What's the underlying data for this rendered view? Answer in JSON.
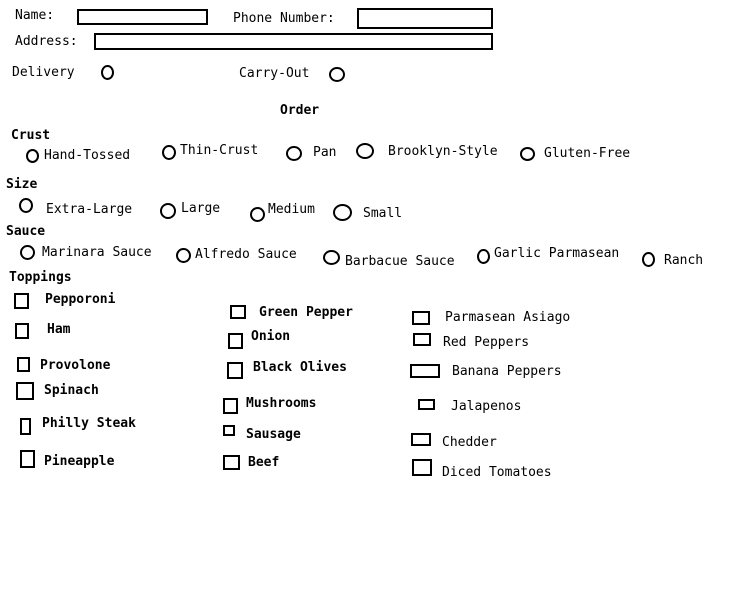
{
  "contact": {
    "name_label": "Name:",
    "phone_label": "Phone Number:",
    "address_label": "Address:",
    "name_value": "",
    "phone_value": "",
    "address_value": ""
  },
  "service": {
    "delivery": "Delivery",
    "carryout": "Carry-Out"
  },
  "order_heading": "Order",
  "crust": {
    "heading": "Crust",
    "options": [
      "Hand-Tossed",
      "Thin-Crust",
      "Pan",
      "Brooklyn-Style",
      "Gluten-Free"
    ]
  },
  "size": {
    "heading": "Size",
    "options": [
      "Extra-Large",
      "Large",
      "Medium",
      "Small"
    ]
  },
  "sauce": {
    "heading": "Sauce",
    "options": [
      "Marinara Sauce",
      "Alfredo Sauce",
      "Barbacue Sauce",
      "Garlic Parmasean",
      "Ranch"
    ]
  },
  "toppings": {
    "heading": "Toppings",
    "items": [
      "Pepporoni",
      "Ham",
      "Provolone",
      "Spinach",
      "Philly Steak",
      "Pineapple",
      "Green Pepper",
      "Onion",
      "Black Olives",
      "Mushrooms",
      "Sausage",
      "Beef",
      "Parmasean Asiago",
      "Red Peppers",
      "Banana Peppers",
      "Jalapenos",
      "Chedder",
      "Diced Tomatoes"
    ]
  }
}
